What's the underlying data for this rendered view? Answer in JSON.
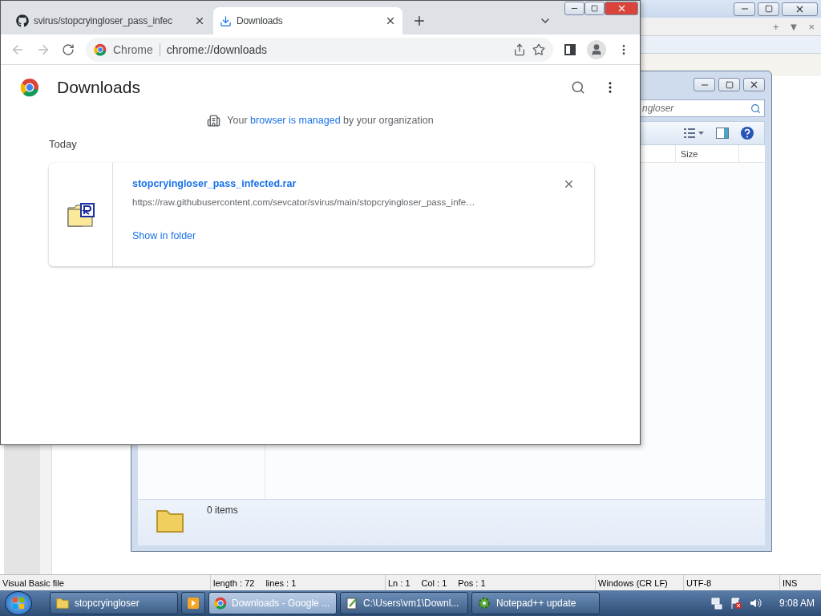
{
  "notepad": {
    "tab_bar_buttons": [
      "+",
      "▼",
      "×"
    ],
    "status_bar": [
      [
        "Visual Basic file"
      ],
      [
        "length : 72",
        "lines : 1"
      ],
      [
        "Ln : 1",
        "Col : 1",
        "Pos : 1"
      ],
      [
        "Windows (CR LF)"
      ],
      [
        "UTF-8"
      ],
      [
        "INS"
      ]
    ]
  },
  "explorer": {
    "search_value": "ngloser",
    "column": "Size",
    "status": "0 items"
  },
  "chrome": {
    "tabs": [
      {
        "kind": "github",
        "title": "svirus/stopcryingloser_pass_infec",
        "selected": false
      },
      {
        "kind": "download",
        "title": "Downloads",
        "selected": true
      }
    ],
    "omnibox": {
      "origin": "Chrome",
      "url": "chrome://downloads"
    },
    "page": {
      "title": "Downloads",
      "notice_before": "Your ",
      "notice_link": "browser is managed",
      "notice_after": " by your organization",
      "section": "Today",
      "items": [
        {
          "filename": "stopcryingloser_pass_infected.rar",
          "url": "https://raw.githubusercontent.com/sevcator/svirus/main/stopcryingloser_pass_infe…",
          "action": "Show in folder"
        }
      ]
    }
  },
  "taskbar": {
    "items": [
      {
        "kind": "folder",
        "label": "stopcryingloser",
        "selected": false
      },
      {
        "kind": "media",
        "selected": false
      },
      {
        "kind": "chrome",
        "label": "Downloads - Google ...",
        "selected": true
      },
      {
        "kind": "notepad",
        "label": "C:\\Users\\vm1\\Downl...",
        "selected": false
      },
      {
        "kind": "updater",
        "label": "Notepad++ update",
        "selected": false
      }
    ],
    "clock": "9:08 AM"
  }
}
